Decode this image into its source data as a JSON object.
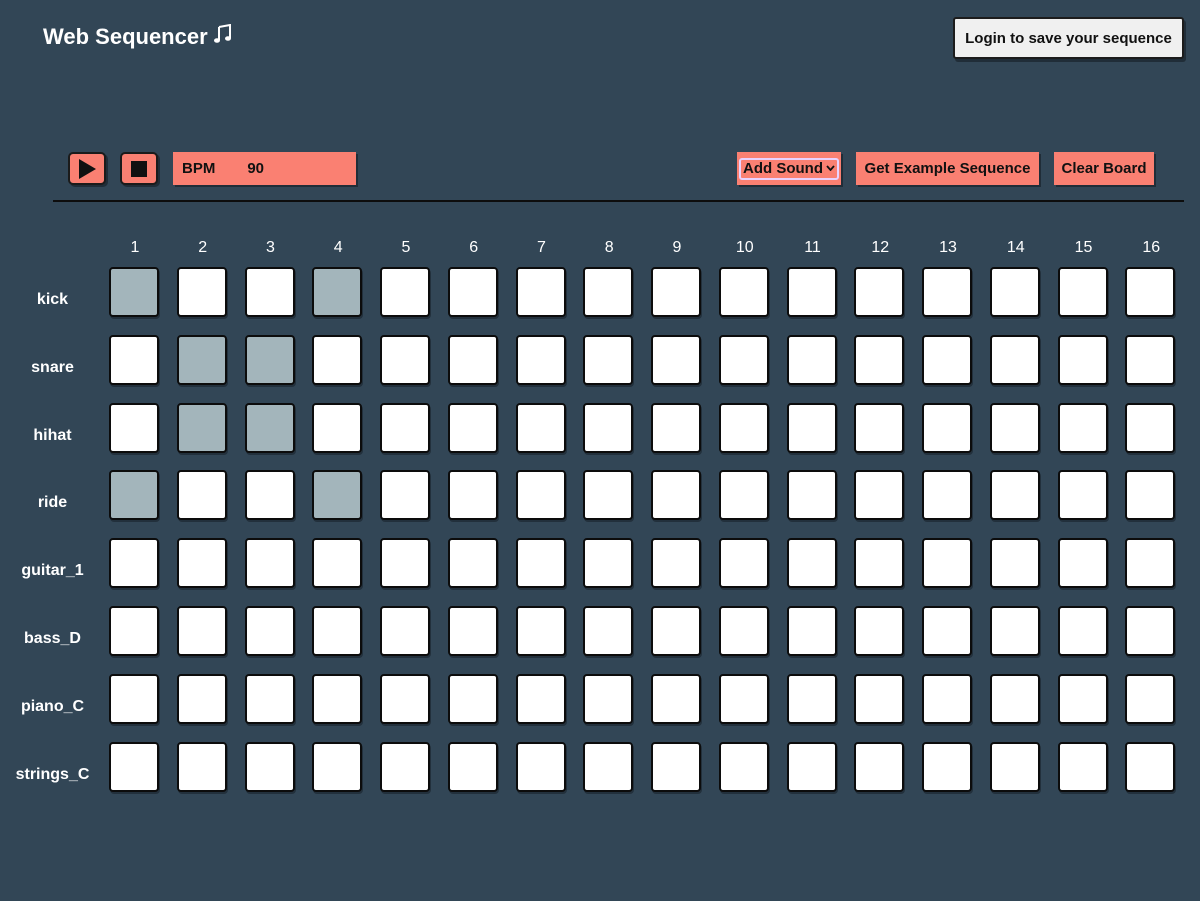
{
  "header": {
    "title": "Web Sequencer",
    "title_icon": "music-note-icon",
    "login_label": "Login to save your sequence"
  },
  "transport": {
    "play_icon": "play-icon",
    "stop_icon": "stop-icon",
    "bpm_label": "BPM",
    "bpm_value": "90"
  },
  "toolbar": {
    "add_sound_label": "Add Sound",
    "example_label": "Get Example Sequence",
    "clear_label": "Clear Board"
  },
  "colors": {
    "background": "#324656",
    "accent": "#fa8072",
    "cell_on": "#a3b5bb",
    "cell_off": "#ffffff"
  },
  "steps": [
    "1",
    "2",
    "3",
    "4",
    "5",
    "6",
    "7",
    "8",
    "9",
    "10",
    "11",
    "12",
    "13",
    "14",
    "15",
    "16"
  ],
  "tracks": [
    {
      "name": "kick",
      "pattern": [
        1,
        0,
        0,
        1,
        0,
        0,
        0,
        0,
        0,
        0,
        0,
        0,
        0,
        0,
        0,
        0
      ]
    },
    {
      "name": "snare",
      "pattern": [
        0,
        1,
        1,
        0,
        0,
        0,
        0,
        0,
        0,
        0,
        0,
        0,
        0,
        0,
        0,
        0
      ]
    },
    {
      "name": "hihat",
      "pattern": [
        0,
        1,
        1,
        0,
        0,
        0,
        0,
        0,
        0,
        0,
        0,
        0,
        0,
        0,
        0,
        0
      ]
    },
    {
      "name": "ride",
      "pattern": [
        1,
        0,
        0,
        1,
        0,
        0,
        0,
        0,
        0,
        0,
        0,
        0,
        0,
        0,
        0,
        0
      ]
    },
    {
      "name": "guitar_1",
      "pattern": [
        0,
        0,
        0,
        0,
        0,
        0,
        0,
        0,
        0,
        0,
        0,
        0,
        0,
        0,
        0,
        0
      ]
    },
    {
      "name": "bass_D",
      "pattern": [
        0,
        0,
        0,
        0,
        0,
        0,
        0,
        0,
        0,
        0,
        0,
        0,
        0,
        0,
        0,
        0
      ]
    },
    {
      "name": "piano_C",
      "pattern": [
        0,
        0,
        0,
        0,
        0,
        0,
        0,
        0,
        0,
        0,
        0,
        0,
        0,
        0,
        0,
        0
      ]
    },
    {
      "name": "strings_C",
      "pattern": [
        0,
        0,
        0,
        0,
        0,
        0,
        0,
        0,
        0,
        0,
        0,
        0,
        0,
        0,
        0,
        0
      ]
    }
  ]
}
